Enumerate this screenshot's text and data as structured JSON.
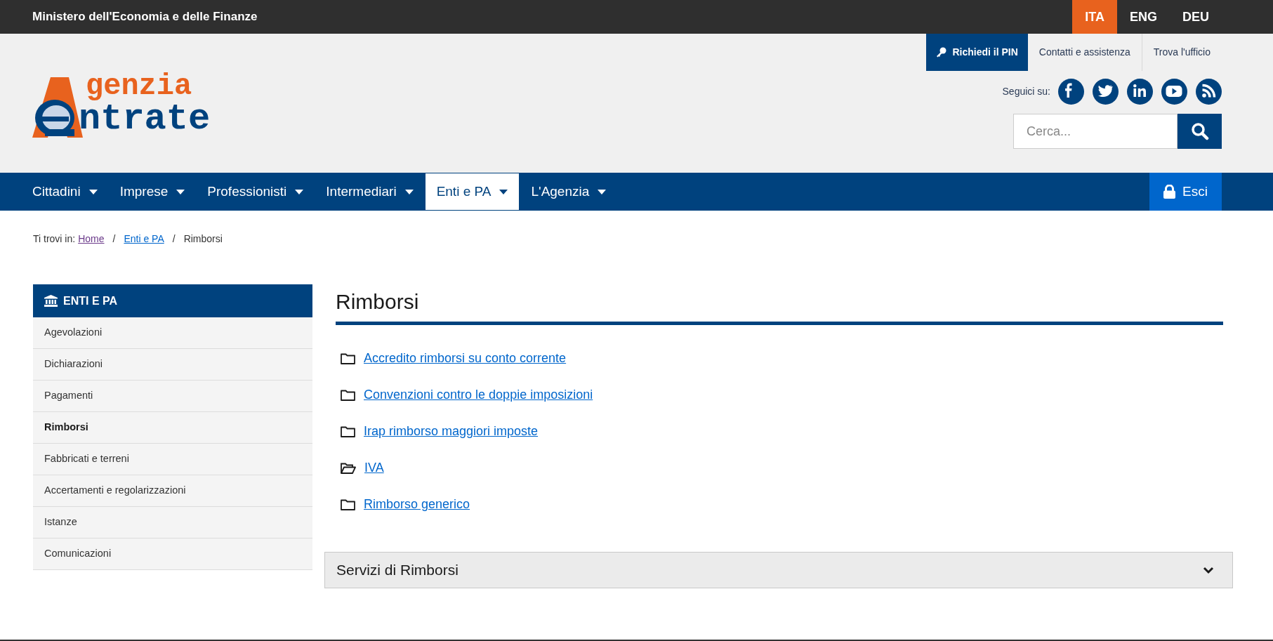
{
  "top_bar": {
    "title": "Ministero dell'Economia e delle Finanze",
    "languages": [
      {
        "label": "ITA",
        "selected": true
      },
      {
        "label": "ENG",
        "selected": false
      },
      {
        "label": "DEU",
        "selected": false
      }
    ]
  },
  "header": {
    "logo": {
      "line_1": "genzia",
      "line_2": "ntrate"
    },
    "utility_links": [
      {
        "label": "Richiedi il PIN",
        "kind": "primary"
      },
      {
        "label": "Contatti e assistenza",
        "kind": "plain"
      },
      {
        "label": "Trova l'ufficio",
        "kind": "plain"
      }
    ],
    "social": {
      "label": "Seguici su:",
      "icons": [
        {
          "kind": "facebook"
        },
        {
          "kind": "twitter"
        },
        {
          "kind": "linkedin"
        },
        {
          "kind": "youtube"
        },
        {
          "kind": "rss"
        }
      ]
    },
    "search": {
      "placeholder": "Cerca..."
    }
  },
  "nav": {
    "items": [
      {
        "label": "Cittadini",
        "selected": false
      },
      {
        "label": "Imprese",
        "selected": false
      },
      {
        "label": "Professionisti",
        "selected": false
      },
      {
        "label": "Intermediari",
        "selected": false
      },
      {
        "label": "Enti e PA",
        "selected": true
      },
      {
        "label": "L'Agenzia",
        "selected": false
      }
    ],
    "logout": "Esci"
  },
  "breadcrumb": {
    "label": "Ti trovi in:",
    "separators": [
      "/",
      "/"
    ],
    "items": [
      {
        "label": "Home",
        "kind": "link"
      },
      {
        "label": "Enti e PA",
        "kind": "link"
      },
      {
        "label": "Rimborsi",
        "kind": "current"
      }
    ]
  },
  "sidebar": {
    "title": "ENTI E PA",
    "items": [
      {
        "label": "Agevolazioni",
        "selected": false
      },
      {
        "label": "Dichiarazioni",
        "selected": false
      },
      {
        "label": "Pagamenti",
        "selected": false
      },
      {
        "label": "Rimborsi",
        "selected": true
      },
      {
        "label": "Fabbricati e terreni",
        "selected": false
      },
      {
        "label": "Accertamenti e regolarizzazioni",
        "selected": false
      },
      {
        "label": "Istanze",
        "selected": false
      },
      {
        "label": "Comunicazioni",
        "selected": false
      }
    ]
  },
  "main": {
    "title": "Rimborsi",
    "links": [
      {
        "label": "Accredito rimborsi su conto corrente",
        "open": false
      },
      {
        "label": "Convenzioni contro le doppie imposizioni",
        "open": false
      },
      {
        "label": "Irap rimborso maggiori imposte",
        "open": false
      },
      {
        "label": "IVA",
        "open": true
      },
      {
        "label": "Rimborso generico",
        "open": false
      }
    ],
    "accordion": {
      "title": "Servizi di Rimborsi",
      "expanded": false
    }
  }
}
